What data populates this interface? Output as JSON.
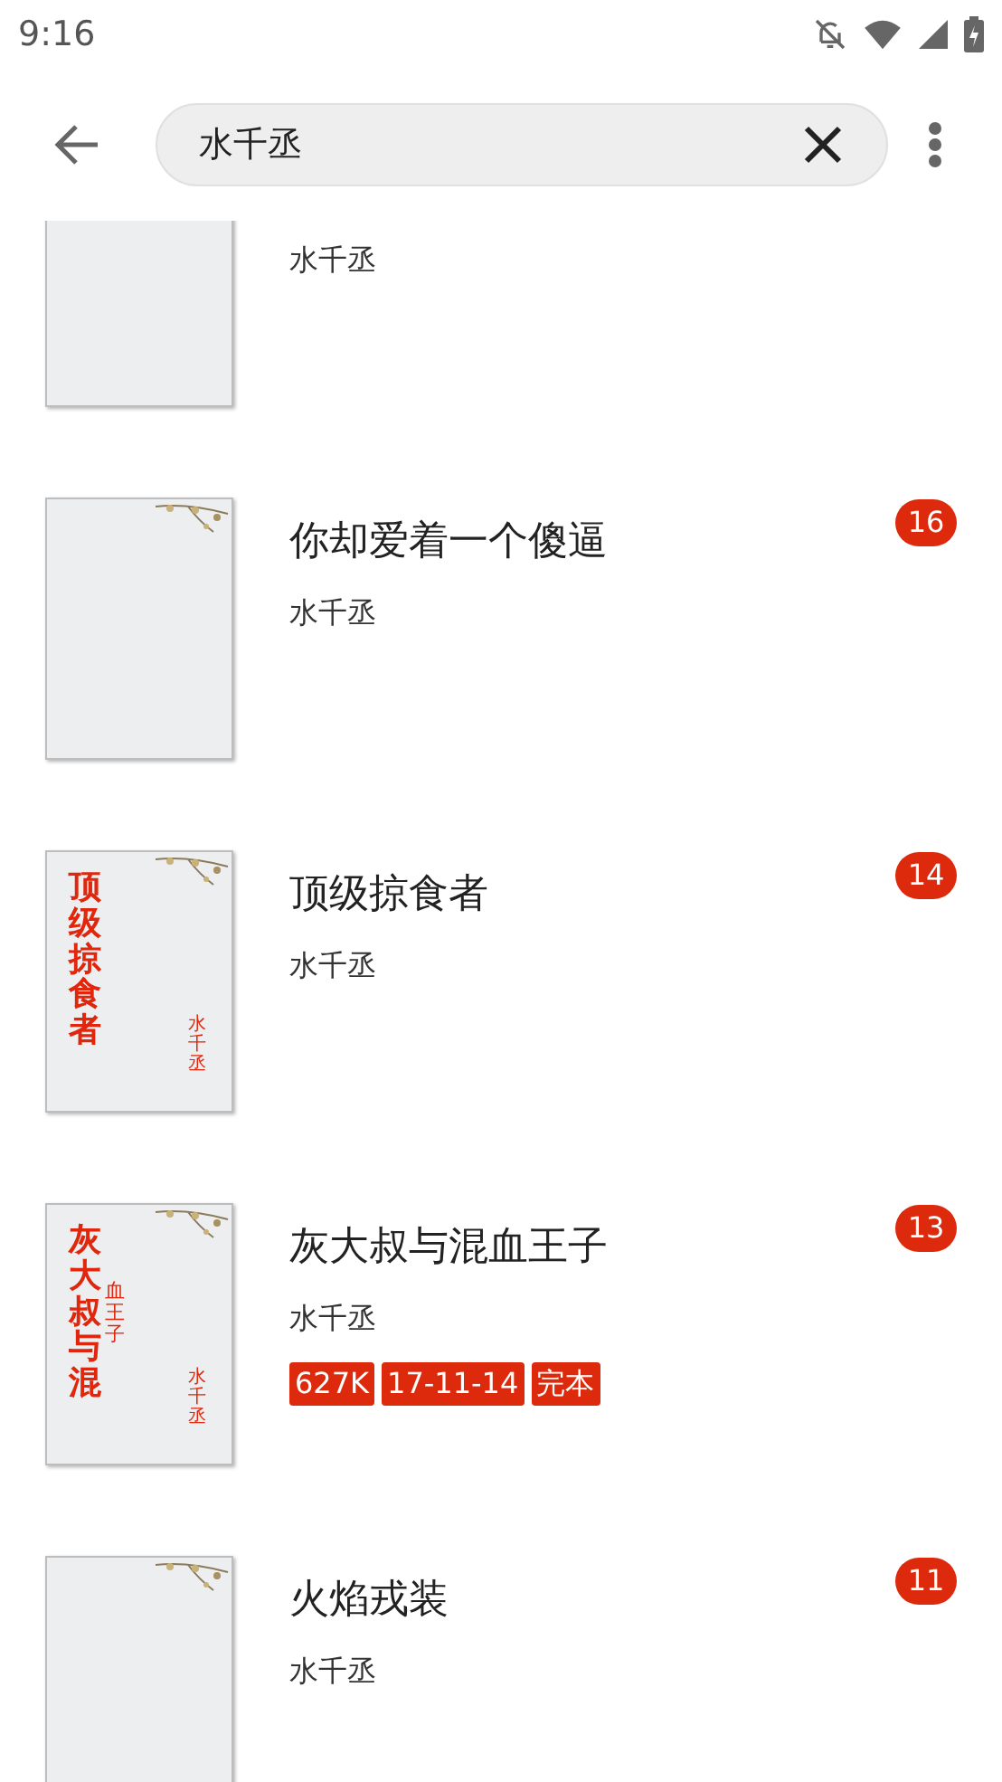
{
  "status_bar": {
    "time": "9:16"
  },
  "search": {
    "value": "水千丞"
  },
  "books": [
    {
      "author": "水千丞"
    },
    {
      "title": "你却爱着一个傻逼",
      "author": "水千丞",
      "count": "16"
    },
    {
      "title": "顶级掠食者",
      "author": "水千丞",
      "count": "14",
      "cover": {
        "title": "顶级掠食者",
        "author": "水千丞"
      }
    },
    {
      "title": "灰大叔与混血王子",
      "author": "水千丞",
      "count": "13",
      "tags": [
        "627K",
        "17-11-14",
        "完本"
      ],
      "cover": {
        "title": "灰大叔与混",
        "subtitle": "血王子",
        "author": "水千丞"
      }
    },
    {
      "title": "火焰戎装",
      "author": "水千丞",
      "count": "11"
    }
  ]
}
